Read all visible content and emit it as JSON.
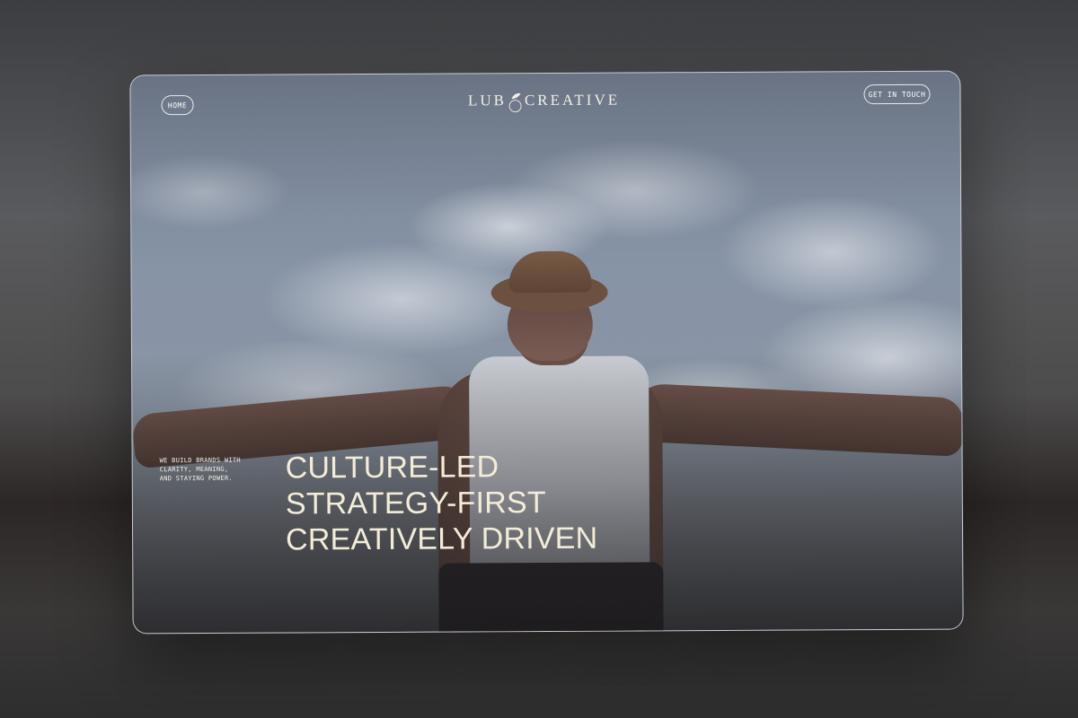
{
  "nav": {
    "home_label": "HOME",
    "logo_left": "LUB",
    "logo_right": "CREATIVE",
    "contact_label": "GET IN TOUCH"
  },
  "hero": {
    "tagline": [
      "WE BUILD BRANDS WITH",
      "CLARITY, MEANING,",
      "AND STAYING POWER."
    ],
    "headline": [
      "CULTURE-LED",
      "STRATEGY-FIRST",
      "CREATIVELY DRIVEN"
    ]
  },
  "colors": {
    "headline_text": "#f3ecd8",
    "pill_border": "#ffffff",
    "backdrop": "#3a3b3e"
  },
  "icons": {
    "logo_mark": "leaf-circle-mark"
  }
}
